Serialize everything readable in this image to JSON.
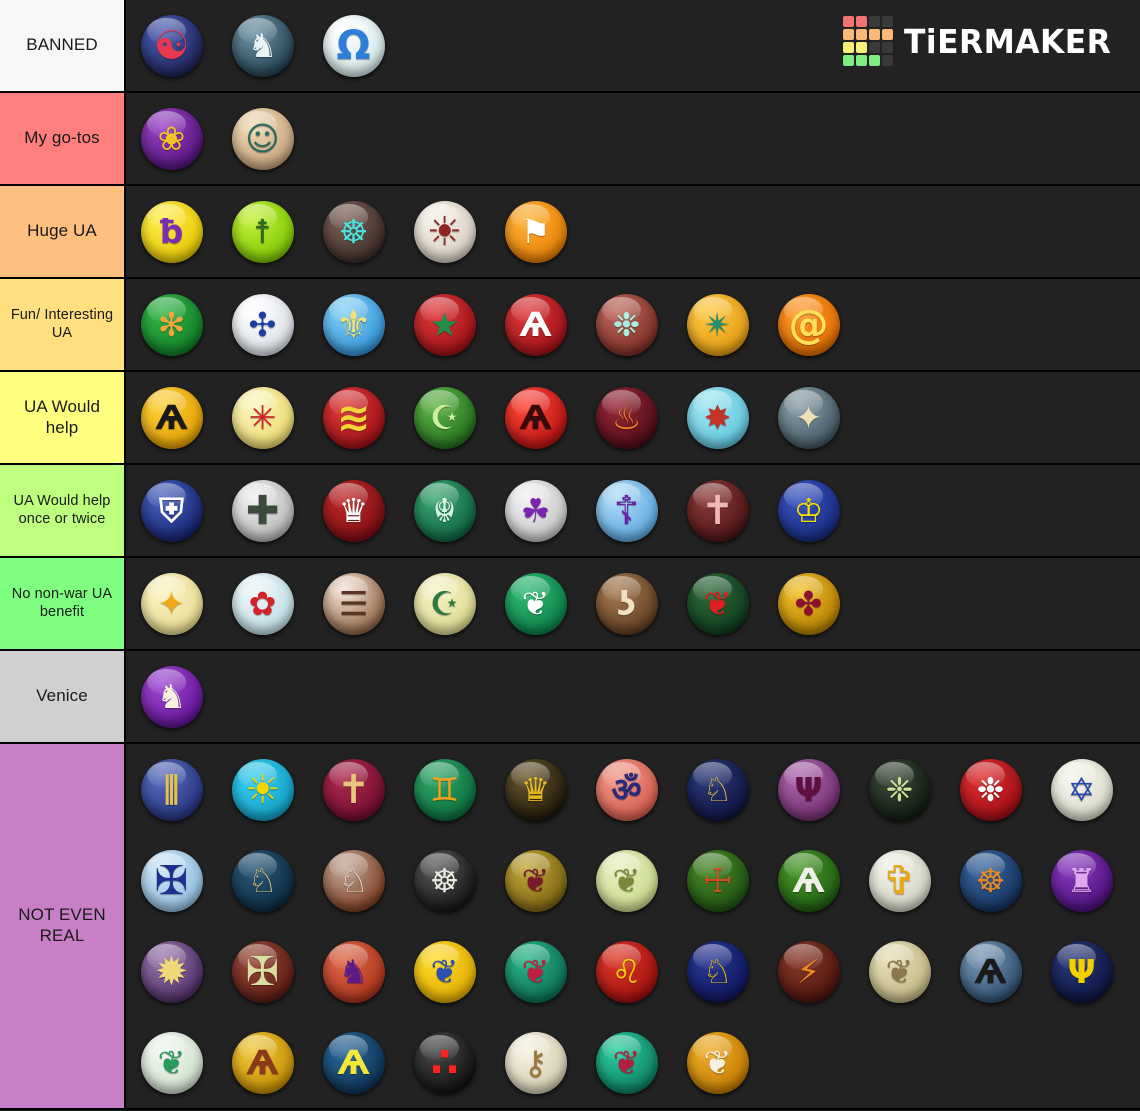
{
  "brand": {
    "name": "TiERMAKER",
    "logo_grid_colors": [
      "#f2736f",
      "#f2736f",
      "#3a3a3a",
      "#3a3a3a",
      "#f7b878",
      "#f7b878",
      "#f7b878",
      "#f7b878",
      "#f4f07a",
      "#f4f07a",
      "#3a3a3a",
      "#3a3a3a",
      "#7ded84",
      "#7ded84",
      "#7ded84",
      "#3a3a3a"
    ]
  },
  "colors": {
    "banned": "#f7f7f7",
    "my_go_tos": "#ff7f7f",
    "huge_ua": "#ffbf7f",
    "fun_ua": "#ffdf7f",
    "ua_would_help": "#ffff7f",
    "ua_help_once": "#bfff7f",
    "no_benefit": "#7fff7f",
    "venice": "#d0d0d0",
    "not_even_real": "#c77fc7",
    "row_background": "#222222",
    "page_background": "#1f1f1f",
    "border": "#000000"
  },
  "tiers": [
    {
      "label": "BANNED",
      "color": "#f7f7f7",
      "rows": 1,
      "items": [
        {
          "name": "korea",
          "glyph": "☯",
          "bg": "radial-gradient(circle at 34% 28%, #4a5fb8, #1d2456 78%)",
          "fg": "#e8384f",
          "size": "lg"
        },
        {
          "name": "greece-pegasus",
          "glyph": "♞",
          "bg": "radial-gradient(circle at 34% 28%, #6f93a6, #20404f 80%)",
          "fg": "#e9f4f7",
          "size": ""
        },
        {
          "name": "omega",
          "glyph": "Ω",
          "bg": "radial-gradient(circle at 34% 28%, #ffffff, #cfe4e6 82%)",
          "fg": "#2f7fd8",
          "size": "lg"
        }
      ]
    },
    {
      "label": "My go-tos",
      "color": "#ff7f7f",
      "rows": 1,
      "items": [
        {
          "name": "rome-laurel",
          "glyph": "❀",
          "bg": "radial-gradient(circle at 34% 28%, #9b45c9, #521178 82%)",
          "fg": "#f2c524",
          "size": ""
        },
        {
          "name": "maya-mask",
          "glyph": "☺",
          "bg": "radial-gradient(circle at 34% 28%, #f0dcb8, #c6a178 82%)",
          "fg": "#2f6b60",
          "size": ""
        }
      ]
    },
    {
      "label": "Huge UA",
      "color": "#ffbf7f",
      "rows": 1,
      "items": [
        {
          "name": "egypt-eye-of-horus",
          "glyph": "ƀ",
          "bg": "radial-gradient(circle at 34% 28%, #ffef4a, #e6c600 82%)",
          "fg": "#7b2fb0",
          "size": ""
        },
        {
          "name": "brazil",
          "glyph": "☨",
          "bg": "radial-gradient(circle at 34% 28%, #c6f23a, #79c400 82%)",
          "fg": "#2e6b1f",
          "size": ""
        },
        {
          "name": "aztec",
          "glyph": "☸",
          "bg": "radial-gradient(circle at 34% 28%, #7e6258, #3a2a26 82%)",
          "fg": "#49e3e0",
          "size": ""
        },
        {
          "name": "persia-sun",
          "glyph": "☀",
          "bg": "radial-gradient(circle at 34% 28%, #f6f1e8, #d6cdc0 82%)",
          "fg": "#8e2424",
          "size": "lg"
        },
        {
          "name": "netherlands-lion",
          "glyph": "⚑",
          "bg": "radial-gradient(circle at 34% 28%, #ffb43a, #e57b00 82%)",
          "fg": "#ffffff",
          "size": ""
        }
      ]
    },
    {
      "label": "Fun/ Interesting UA",
      "color": "#ffdf7f",
      "rows": 1,
      "items": [
        {
          "name": "india-chakra",
          "glyph": "✻",
          "bg": "radial-gradient(circle at 34% 28%, #35b84a, #0e7a24 82%)",
          "fg": "#f0a63c",
          "size": ""
        },
        {
          "name": "portugal",
          "glyph": "✣",
          "bg": "radial-gradient(circle at 34% 28%, #ffffff, #d8dde4 82%)",
          "fg": "#1e3fa0",
          "size": ""
        },
        {
          "name": "france-fleur-de-lis",
          "glyph": "⚜",
          "bg": "radial-gradient(circle at 34% 28%, #86d2f7, #2e90d6 82%)",
          "fg": "#f2e07a",
          "size": "lg"
        },
        {
          "name": "morocco-star",
          "glyph": "★",
          "bg": "radial-gradient(circle at 34% 28%, #e03a3a, #9b0f14 82%)",
          "fg": "#1f8f4a",
          "size": ""
        },
        {
          "name": "poland-eagle",
          "glyph": "Ѧ",
          "bg": "radial-gradient(circle at 34% 28%, #e03a3a, #9b0f14 82%)",
          "fg": "#ffffff",
          "size": ""
        },
        {
          "name": "assyria",
          "glyph": "❉",
          "bg": "radial-gradient(circle at 34% 28%, #bd6a5c, #7a2a22 82%)",
          "fg": "#a9ece0",
          "size": ""
        },
        {
          "name": "maya-2",
          "glyph": "✴",
          "bg": "radial-gradient(circle at 34% 28%, #ffc845, #e39a10 82%)",
          "fg": "#1b8f6e",
          "size": ""
        },
        {
          "name": "polynesia-spiral",
          "glyph": "@",
          "bg": "radial-gradient(circle at 34% 28%, #ff9a26, #e06a00 82%)",
          "fg": "#ffe05a",
          "size": "lg"
        }
      ]
    },
    {
      "label": "UA Would help",
      "color": "#ffff7f",
      "rows": 1,
      "items": [
        {
          "name": "austria-eagle",
          "glyph": "Ѧ",
          "bg": "radial-gradient(circle at 34% 28%, #ffd23a, #e09c00 82%)",
          "fg": "#1a1a1a",
          "size": ""
        },
        {
          "name": "macedon-star",
          "glyph": "✳",
          "bg": "radial-gradient(circle at 34% 28%, #fdf6c0, #ead96a 82%)",
          "fg": "#d2232a",
          "size": ""
        },
        {
          "name": "china-dragon",
          "glyph": "≋",
          "bg": "radial-gradient(circle at 34% 28%, #e03a3a, #9b0f14 82%)",
          "fg": "#f5d33a",
          "size": "lg"
        },
        {
          "name": "ottoman-crescent",
          "glyph": "☪",
          "bg": "radial-gradient(circle at 34% 28%, #63b84a, #206b1c 82%)",
          "fg": "#cdf0a0",
          "size": ""
        },
        {
          "name": "germany-eagle",
          "glyph": "Ѧ",
          "bg": "radial-gradient(circle at 34% 28%, #ff4a3a, #b50f0f 82%)",
          "fg": "#3a0a0a",
          "size": ""
        },
        {
          "name": "zulu-flame",
          "glyph": "♨",
          "bg": "radial-gradient(circle at 34% 28%, #9b2a3a, #4a0a14 82%)",
          "fg": "#ff8a1f",
          "size": ""
        },
        {
          "name": "babylon-star",
          "glyph": "✸",
          "bg": "radial-gradient(circle at 34% 28%, #9fe6f2, #5fc4de 82%)",
          "fg": "#c0342a",
          "size": ""
        },
        {
          "name": "byzantine",
          "glyph": "✦",
          "bg": "radial-gradient(circle at 34% 28%, #8fa3ad, #3d525e 82%)",
          "fg": "#f0dfb8",
          "size": ""
        }
      ]
    },
    {
      "label": "UA Would help once or twice",
      "color": "#bfff7f",
      "rows": 1,
      "items": [
        {
          "name": "america-shield",
          "glyph": "⛨",
          "bg": "radial-gradient(circle at 34% 28%, #4a63c2, #14206b 82%)",
          "fg": "#ffffff",
          "size": ""
        },
        {
          "name": "germany-iron-cross",
          "glyph": "✚",
          "bg": "radial-gradient(circle at 34% 28%, #f0f0f0, #b4b4b4 82%)",
          "fg": "#3c4a3c",
          "size": "lg"
        },
        {
          "name": "england-crown",
          "glyph": "♛",
          "bg": "radial-gradient(circle at 34% 28%, #c32a2a, #780c12 82%)",
          "fg": "#ffffff",
          "size": ""
        },
        {
          "name": "celts-knot",
          "glyph": "☬",
          "bg": "radial-gradient(circle at 34% 28%, #3aa872, #0e6040 82%)",
          "fg": "#d8f4e4",
          "size": ""
        },
        {
          "name": "carthage-elephant",
          "glyph": "☘",
          "bg": "radial-gradient(circle at 34% 28%, #f2f2f2, #c4c4c4 82%)",
          "fg": "#7c23b0",
          "size": ""
        },
        {
          "name": "russia-orthodox-cross",
          "glyph": "☦",
          "bg": "radial-gradient(circle at 34% 28%, #b0ddf7, #5aa6e0 82%)",
          "fg": "#6b1fa8",
          "size": "lg"
        },
        {
          "name": "spain-cross",
          "glyph": "✝",
          "bg": "radial-gradient(circle at 34% 28%, #8e3a3a, #4a1414 82%)",
          "fg": "#f2b8b8",
          "size": "lg"
        },
        {
          "name": "sweden-crowns",
          "glyph": "♔",
          "bg": "radial-gradient(circle at 34% 28%, #3a55c2, #152a7d 82%)",
          "fg": "#f5e000",
          "size": ""
        }
      ]
    },
    {
      "label": "No non-war UA benefit",
      "color": "#7fff7f",
      "rows": 1,
      "items": [
        {
          "name": "siam-star",
          "glyph": "✦",
          "bg": "radial-gradient(circle at 34% 28%, #fbf3c4, #e8dc8e 82%)",
          "fg": "#f0a818",
          "size": ""
        },
        {
          "name": "korea-blossom",
          "glyph": "✿",
          "bg": "radial-gradient(circle at 34% 28%, #eef6f8, #bddde6 82%)",
          "fg": "#d2232a",
          "size": ""
        },
        {
          "name": "china-trigram",
          "glyph": "☰",
          "bg": "radial-gradient(circle at 34% 28%, #f5e6d8, #8a5c3c 82%)",
          "fg": "#5a3420",
          "size": ""
        },
        {
          "name": "arabia-crescent",
          "glyph": "☪",
          "bg": "radial-gradient(circle at 34% 28%, #f6f3c8, #ddd88c 82%)",
          "fg": "#2a7a42",
          "size": ""
        },
        {
          "name": "iroquois",
          "glyph": "❦",
          "bg": "radial-gradient(circle at 34% 28%, #2fbd72, #0a7c46 82%)",
          "fg": "#ffffff",
          "size": ""
        },
        {
          "name": "songhai-triskele",
          "glyph": "ʖ",
          "bg": "radial-gradient(circle at 34% 28%, #a87c52, #5e3a1e 82%)",
          "fg": "#f0e0c0",
          "size": ""
        },
        {
          "name": "wales-dragon",
          "glyph": "❦",
          "bg": "radial-gradient(circle at 34% 28%, #2e6b3a, #0e3a1c 82%)",
          "fg": "#e02020",
          "size": ""
        },
        {
          "name": "mongolia",
          "glyph": "✤",
          "bg": "radial-gradient(circle at 34% 28%, #f2c22a, #b07a00 82%)",
          "fg": "#8e1030",
          "size": ""
        }
      ]
    },
    {
      "label": "Venice",
      "color": "#d0d0d0",
      "rows": 1,
      "items": [
        {
          "name": "venice-winged-lion",
          "glyph": "♞",
          "bg": "radial-gradient(circle at 34% 28%, #a24ad6, #5e1090 82%)",
          "fg": "#f7f2e0",
          "size": ""
        }
      ]
    },
    {
      "label": "NOT EVEN REAL",
      "color": "#c77fc7",
      "rows": 4,
      "items": [
        {
          "name": "hittites",
          "glyph": "⫼",
          "bg": "radial-gradient(circle at 34% 28%, #5a6fc0, #22307a 82%)",
          "fg": "#e6c250",
          "size": ""
        },
        {
          "name": "inca-sun",
          "glyph": "☀",
          "bg": "radial-gradient(circle at 34% 28%, #3ad0f2, #0f9ec4 82%)",
          "fg": "#f2d400",
          "size": "lg"
        },
        {
          "name": "armenia-cross",
          "glyph": "✝",
          "bg": "radial-gradient(circle at 34% 28%, #b02a52, #6e0c2c 82%)",
          "fg": "#e8c878",
          "size": "lg"
        },
        {
          "name": "australia-kangaroo",
          "glyph": "♊",
          "bg": "radial-gradient(circle at 34% 28%, #2fa868, #0c6b3c 82%)",
          "fg": "#f0a418",
          "size": ""
        },
        {
          "name": "holy-roman-empire",
          "glyph": "♛",
          "bg": "radial-gradient(circle at 34% 28%, #6b5a30, #1c1508 82%)",
          "fg": "#e8b820",
          "size": ""
        },
        {
          "name": "phoenicia",
          "glyph": "ॐ",
          "bg": "radial-gradient(circle at 34% 28%, #f09a8a, #d65a4a 82%)",
          "fg": "#2a2a7a",
          "size": ""
        },
        {
          "name": "scythia-horse",
          "glyph": "♘",
          "bg": "radial-gradient(circle at 34% 28%, #2a3a7a, #0e1440 82%)",
          "fg": "#e8c44a",
          "size": ""
        },
        {
          "name": "hungary-magyar",
          "glyph": "Ψ",
          "bg": "radial-gradient(circle at 34% 28%, #b06ab0, #6e2a6e 82%)",
          "fg": "#5e1040",
          "size": ""
        },
        {
          "name": "assyria-palm",
          "glyph": "❈",
          "bg": "radial-gradient(circle at 34% 28%, #3a4a3a, #111a11 82%)",
          "fg": "#cfe09a",
          "size": ""
        },
        {
          "name": "switzerland-star",
          "glyph": "❉",
          "bg": "radial-gradient(circle at 34% 28%, #e03030, #9b0c14 82%)",
          "fg": "#ffffff",
          "size": ""
        },
        {
          "name": "israel-star-of-david",
          "glyph": "✡",
          "bg": "radial-gradient(circle at 34% 28%, #f6f6ee, #d8d8c8 82%)",
          "fg": "#2a4ab0",
          "size": ""
        },
        {
          "name": "normandy-cross",
          "glyph": "✠",
          "bg": "radial-gradient(circle at 34% 28%, #cfe6f7, #8fbde0 82%)",
          "fg": "#1e2f90",
          "size": "lg"
        },
        {
          "name": "bohemia-lion",
          "glyph": "♘",
          "bg": "radial-gradient(circle at 34% 28%, #2a5a7a, #0c2a42 82%)",
          "fg": "#e8c87a",
          "size": ""
        },
        {
          "name": "hunnic-horse",
          "glyph": "♘",
          "bg": "radial-gradient(circle at 34% 28%, #c4a898, #7a3a1e 82%)",
          "fg": "#e6e0d8",
          "size": ""
        },
        {
          "name": "nazca-spider",
          "glyph": "☸",
          "bg": "radial-gradient(circle at 34% 28%, #5a5a5a, #121212 82%)",
          "fg": "#e8e8e0",
          "size": ""
        },
        {
          "name": "thunderbird",
          "glyph": "❦",
          "bg": "radial-gradient(circle at 34% 28%, #c2a83a, #7a6010 82%)",
          "fg": "#7a1a2a",
          "size": ""
        },
        {
          "name": "canaan-wheat",
          "glyph": "❦",
          "bg": "radial-gradient(circle at 34% 28%, #e8f0c0, #c8d88a 82%)",
          "fg": "#7a8a3a",
          "size": ""
        },
        {
          "name": "hungary-shield",
          "glyph": "☩",
          "bg": "radial-gradient(circle at 34% 28%, #4a8a2a, #1c5010 82%)",
          "fg": "#e04a20",
          "size": ""
        },
        {
          "name": "poland-white-eagle",
          "glyph": "Ѧ",
          "bg": "radial-gradient(circle at 34% 28%, #4a9a2a, #1c5a10 82%)",
          "fg": "#f0f0e8",
          "size": ""
        },
        {
          "name": "jerusalem-cross",
          "glyph": "✞",
          "bg": "radial-gradient(circle at 34% 28%, #f2f2ea, #cfcfc0 82%)",
          "fg": "#e8a818",
          "size": "lg"
        },
        {
          "name": "sumeria",
          "glyph": "☸",
          "bg": "radial-gradient(circle at 34% 28%, #3a6aa0, #14305e 82%)",
          "fg": "#e88a2a",
          "size": ""
        },
        {
          "name": "elam-throne",
          "glyph": "♜",
          "bg": "radial-gradient(circle at 34% 28%, #8a3ac0, #4a0e78 82%)",
          "fg": "#e0a8f0",
          "size": ""
        },
        {
          "name": "macedon-vergina-sun",
          "glyph": "✹",
          "bg": "radial-gradient(circle at 34% 28%, #9a7ab0, #4a2a62 82%)",
          "fg": "#f0d87a",
          "size": "lg"
        },
        {
          "name": "templar-cross",
          "glyph": "✠",
          "bg": "radial-gradient(circle at 34% 28%, #9a4a3a, #5a1a12 82%)",
          "fg": "#d8dfa0",
          "size": "lg"
        },
        {
          "name": "burgundy-knight",
          "glyph": "♞",
          "bg": "radial-gradient(circle at 34% 28%, #e06a4a, #a8301a 82%)",
          "fg": "#5a1a8a",
          "size": ""
        },
        {
          "name": "sweden-lion",
          "glyph": "❦",
          "bg": "radial-gradient(circle at 34% 28%, #ffdd2a, #e0aa00 82%)",
          "fg": "#2a50b0",
          "size": ""
        },
        {
          "name": "wales-red-dragon",
          "glyph": "❦",
          "bg": "radial-gradient(circle at 34% 28%, #2ab88a, #0c6a52 82%)",
          "fg": "#c02040",
          "size": ""
        },
        {
          "name": "england-lions",
          "glyph": "♌",
          "bg": "radial-gradient(circle at 34% 28%, #e03a2a, #9b0c0c 82%)",
          "fg": "#f2d000",
          "size": ""
        },
        {
          "name": "flanders-lion",
          "glyph": "♘",
          "bg": "radial-gradient(circle at 34% 28%, #2a3a9a, #0e1458 82%)",
          "fg": "#f2d000",
          "size": ""
        },
        {
          "name": "gaul-lightning",
          "glyph": "⚡",
          "bg": "radial-gradient(circle at 34% 28%, #8a3a2a, #4a120c 82%)",
          "fg": "#f08820",
          "size": ""
        },
        {
          "name": "nubia-eagle",
          "glyph": "❦",
          "bg": "radial-gradient(circle at 34% 28%, #e8e0b8, #c0b480 82%)",
          "fg": "#8a7a4a",
          "size": ""
        },
        {
          "name": "prussia-black-eagle",
          "glyph": "Ѧ",
          "bg": "radial-gradient(circle at 34% 28%, #7a98b8, #2a4a6a 82%)",
          "fg": "#1a1a1a",
          "size": ""
        },
        {
          "name": "ukraine-trident",
          "glyph": "Ψ",
          "bg": "radial-gradient(circle at 34% 28%, #2a3a7a, #0c1442 82%)",
          "fg": "#f2d000",
          "size": ""
        },
        {
          "name": "ireland-harp",
          "glyph": "❦",
          "bg": "radial-gradient(circle at 34% 28%, #f2f6f0, #cfe0cc 82%)",
          "fg": "#2a9a5a",
          "size": ""
        },
        {
          "name": "russia-double-eagle",
          "glyph": "Ѧ",
          "bg": "radial-gradient(circle at 34% 28%, #f0c83a, #c08a00 82%)",
          "fg": "#8a3a1a",
          "size": ""
        },
        {
          "name": "prussia-eagle",
          "glyph": "Ѧ",
          "bg": "radial-gradient(circle at 34% 28%, #2a6a9a, #0c3052 82%)",
          "fg": "#f2e83a",
          "size": ""
        },
        {
          "name": "triple-dot",
          "glyph": "∴",
          "bg": "radial-gradient(circle at 34% 28%, #4a4a4a, #0e0e0e 82%)",
          "fg": "#ff2020",
          "size": "lg"
        },
        {
          "name": "papal-keys",
          "glyph": "⚷",
          "bg": "radial-gradient(circle at 34% 28%, #f6f2e2, #d4ccb0 82%)",
          "fg": "#9a7a3a",
          "size": ""
        },
        {
          "name": "china-red-dragon",
          "glyph": "❦",
          "bg": "radial-gradient(circle at 34% 28%, #2ad0a0, #0c7a60 82%)",
          "fg": "#b02040",
          "size": ""
        },
        {
          "name": "egypt-vulture",
          "glyph": "❦",
          "bg": "radial-gradient(circle at 34% 28%, #f0b02a, #c07800 82%)",
          "fg": "#f6f0e0",
          "size": ""
        }
      ]
    }
  ]
}
